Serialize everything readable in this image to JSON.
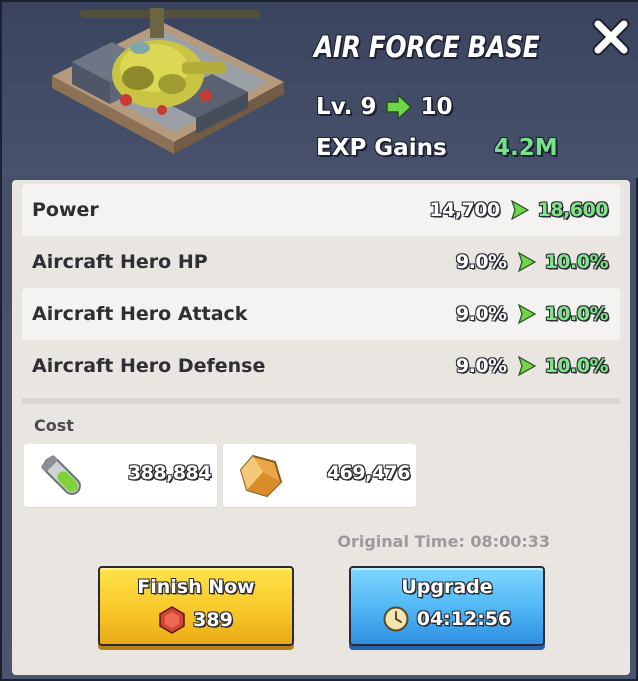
{
  "header": {
    "title": "AIR FORCE BASE",
    "level_prefix": "Lv. 9",
    "level_next": "10",
    "exp_label": "EXP Gains",
    "exp_value": "4.2M"
  },
  "stats": [
    {
      "label": "Power",
      "old": "14,700",
      "new": "18,600"
    },
    {
      "label": "Aircraft Hero HP",
      "old": "9.0%",
      "new": "10.0%"
    },
    {
      "label": "Aircraft Hero Attack",
      "old": "9.0%",
      "new": "10.0%"
    },
    {
      "label": "Aircraft Hero Defense",
      "old": "9.0%",
      "new": "10.0%"
    }
  ],
  "cost": {
    "label": "Cost",
    "items": [
      {
        "icon": "vial-icon",
        "value": "388,884"
      },
      {
        "icon": "crystal-icon",
        "value": "469,476"
      }
    ]
  },
  "original_time": "Original Time: 08:00:33",
  "buttons": {
    "finish": {
      "label": "Finish Now",
      "gems": "389"
    },
    "upgrade": {
      "label": "Upgrade",
      "time": "04:12:56"
    }
  },
  "colors": {
    "increase_green": "#7fe38a",
    "finish_button": "#f8c92a",
    "upgrade_button": "#4fb5f4",
    "panel_bg": "#e9e6e2"
  }
}
